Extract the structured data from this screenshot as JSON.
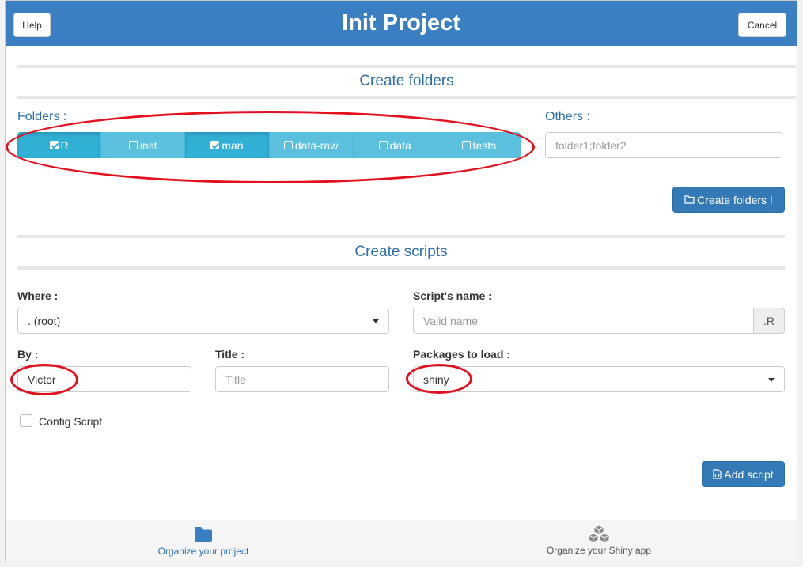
{
  "header": {
    "title": "Init Project",
    "help_label": "Help",
    "cancel_label": "Cancel"
  },
  "folders": {
    "section_title": "Create folders",
    "folders_label": "Folders :",
    "others_label": "Others :",
    "others_placeholder": "folder1;folder2",
    "options": [
      {
        "label": "R",
        "checked": true
      },
      {
        "label": "inst",
        "checked": false
      },
      {
        "label": "man",
        "checked": true
      },
      {
        "label": "data-raw",
        "checked": false
      },
      {
        "label": "data",
        "checked": false
      },
      {
        "label": "tests",
        "checked": false
      }
    ],
    "create_button": "Create folders !"
  },
  "scripts": {
    "section_title": "Create scripts",
    "where_label": "Where :",
    "where_value": ". (root)",
    "name_label": "Script's name :",
    "name_placeholder": "Valid name",
    "name_suffix": ".R",
    "by_label": "By :",
    "by_value": "Victor",
    "title_label": "Title :",
    "title_placeholder": "Title",
    "packages_label": "Packages to load :",
    "packages_value": "shiny",
    "config_label": "Config Script",
    "add_button": "Add script"
  },
  "footer": {
    "tab_organize_project": "Organize your project",
    "tab_organize_shiny": "Organize your Shiny app"
  },
  "colors": {
    "header": "#3a7fc1",
    "segment": "#5bc0de",
    "segment_active": "#31b0d5",
    "primary": "#337ab7",
    "annotation": "#e3101e"
  }
}
